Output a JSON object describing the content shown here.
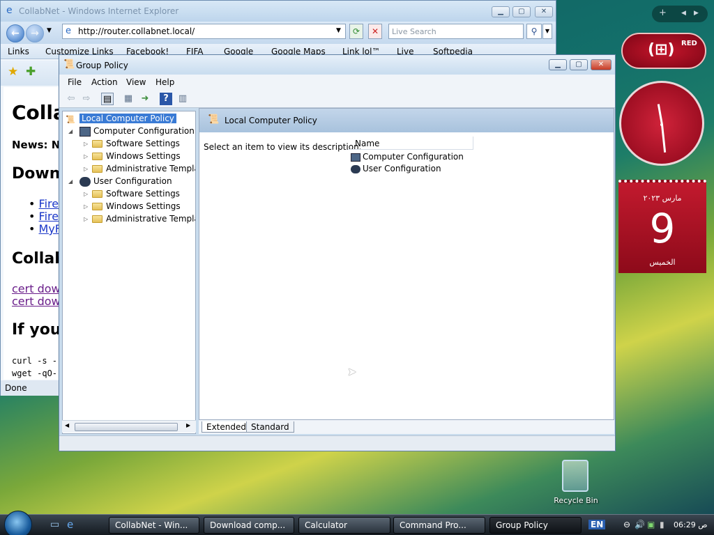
{
  "ie": {
    "title": "CollabNet - Windows Internet Explorer",
    "address": "http://router.collabnet.local/",
    "search_placeholder": "Live Search",
    "links": [
      "Links",
      "Customize Links",
      "Facebook!",
      "FIFA",
      "Google",
      "Google Maps",
      "Link lol™",
      "Live",
      "Softpedia"
    ],
    "content": {
      "heading1": "Colla",
      "news": "News: N",
      "heading2": "Down",
      "items": [
        "Fire",
        "Fire",
        "MyF"
      ],
      "heading3": "Collab",
      "cert1": "cert down",
      "cert2": "cert down",
      "heading4": "If you",
      "code1": "curl -s -",
      "code2": "wget -qO-"
    },
    "status": "Done"
  },
  "gp": {
    "title": "Group Policy",
    "menu": [
      "File",
      "Action",
      "View",
      "Help"
    ],
    "tree": {
      "root": "Local Computer Policy",
      "computer": "Computer Configuration",
      "user": "User Configuration",
      "children": [
        "Software Settings",
        "Windows Settings",
        "Administrative Templates"
      ]
    },
    "right": {
      "header": "Local Computer Policy",
      "description": "Select an item to view its description.",
      "column": "Name",
      "items": [
        "Computer Configuration",
        "User Configuration"
      ]
    },
    "tabs": [
      "Extended",
      "Standard"
    ]
  },
  "gadgets": {
    "red_label": "RED",
    "calendar": {
      "month": "مارس ٢٠٢٣",
      "day": "9",
      "weekday": "الخميس"
    }
  },
  "desktop": {
    "recycle_bin": "Recycle Bin"
  },
  "taskbar": {
    "tasks": [
      "CollabNet - Win...",
      "Download comp...",
      "Calculator",
      "Command Pro...",
      "Group Policy"
    ],
    "lang": "EN",
    "time": "06:29 ص"
  },
  "colors": {
    "accent": "#3a7bd5",
    "taskbar": "#1c232a",
    "gadget_red": "#c21a2e"
  }
}
